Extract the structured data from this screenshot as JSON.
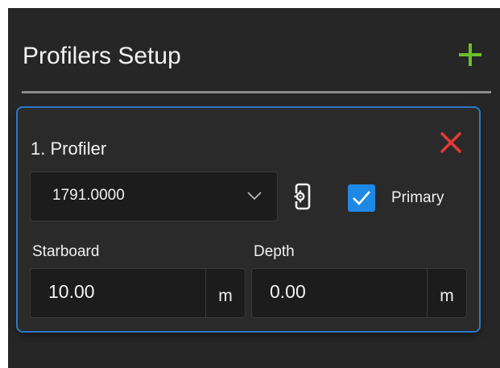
{
  "panel": {
    "title": "Profilers Setup",
    "add_icon": "plus-icon",
    "accent_add": "#6cbf2a"
  },
  "profiler": {
    "title": "1. Profiler",
    "remove_icon": "close-x-icon",
    "remove_color": "#e53935",
    "border_color": "#2c78c6",
    "select": {
      "value": "1791.0000",
      "chevron_icon": "chevron-down-icon"
    },
    "device_icon": "device-settings-icon",
    "primary": {
      "checked": true,
      "label": "Primary",
      "checkbox_color": "#1e88e5"
    },
    "starboard": {
      "label": "Starboard",
      "value": "10.00",
      "unit": "m"
    },
    "depth": {
      "label": "Depth",
      "value": "0.00",
      "unit": "m"
    }
  }
}
